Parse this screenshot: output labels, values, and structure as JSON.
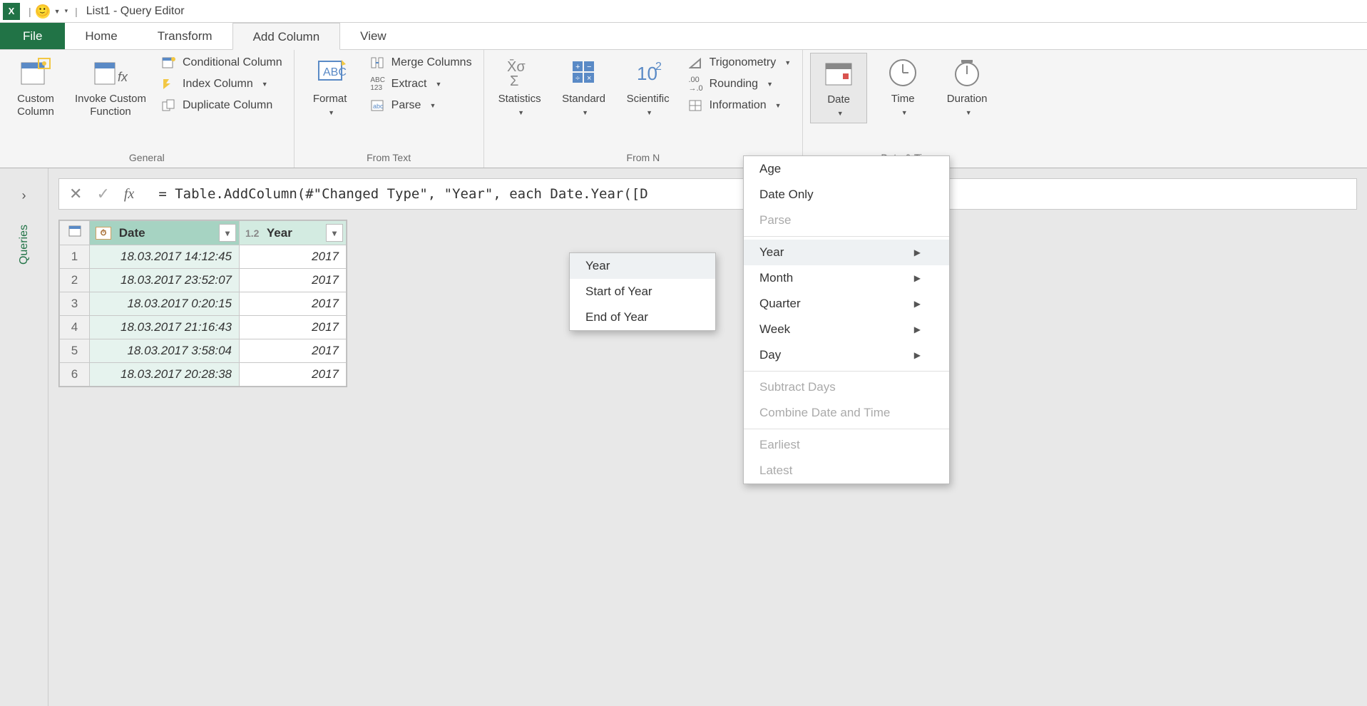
{
  "titlebar": {
    "title": "List1 - Query Editor"
  },
  "tabs": {
    "file": "File",
    "home": "Home",
    "transform": "Transform",
    "add_column": "Add Column",
    "view": "View"
  },
  "ribbon": {
    "general": {
      "label": "General",
      "custom_column": "Custom\nColumn",
      "invoke_custom": "Invoke Custom\nFunction",
      "conditional": "Conditional Column",
      "index": "Index Column",
      "duplicate": "Duplicate Column"
    },
    "from_text": {
      "label": "From Text",
      "format": "Format",
      "merge": "Merge Columns",
      "extract": "Extract",
      "parse": "Parse"
    },
    "from_number": {
      "label": "From N",
      "statistics": "Statistics",
      "standard": "Standard",
      "scientific": "Scientific",
      "trig": "Trigonometry",
      "rounding": "Rounding",
      "info": "Information"
    },
    "from_datetime": {
      "label": "m Date & Time",
      "date": "Date",
      "time": "Time",
      "duration": "Duration"
    }
  },
  "sidebar": {
    "queries": "Queries"
  },
  "formula": "= Table.AddColumn(#\"Changed Type\", \"Year\", each Date.Year([D",
  "grid": {
    "col1": "Date",
    "col2": "Year",
    "type2_label": "1.2",
    "rows": [
      {
        "n": "1",
        "date": "18.03.2017 14:12:45",
        "year": "2017"
      },
      {
        "n": "2",
        "date": "18.03.2017 23:52:07",
        "year": "2017"
      },
      {
        "n": "3",
        "date": "18.03.2017 0:20:15",
        "year": "2017"
      },
      {
        "n": "4",
        "date": "18.03.2017 21:16:43",
        "year": "2017"
      },
      {
        "n": "5",
        "date": "18.03.2017 3:58:04",
        "year": "2017"
      },
      {
        "n": "6",
        "date": "18.03.2017 20:28:38",
        "year": "2017"
      }
    ]
  },
  "date_menu": {
    "age": "Age",
    "date_only": "Date Only",
    "parse": "Parse",
    "year": "Year",
    "month": "Month",
    "quarter": "Quarter",
    "week": "Week",
    "day": "Day",
    "subtract": "Subtract Days",
    "combine": "Combine Date and Time",
    "earliest": "Earliest",
    "latest": "Latest"
  },
  "year_submenu": {
    "year": "Year",
    "start": "Start of Year",
    "end": "End of Year"
  }
}
